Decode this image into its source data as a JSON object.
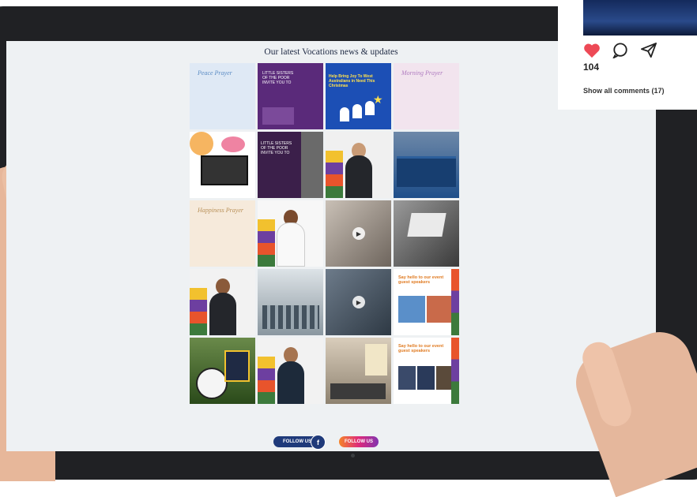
{
  "page": {
    "heading": "Our latest Vocations news & updates"
  },
  "tiles": [
    {
      "name": "tile-peace-prayer",
      "bg": "#dfe9f5",
      "text": "Peace Prayer",
      "color": "#5b8cc4"
    },
    {
      "name": "tile-little-sisters-1",
      "bg": "#5a2a7a",
      "text": "LITTLE SISTERS OF THE POOR INVITE YOU TO",
      "color": "#ffffff"
    },
    {
      "name": "tile-christmas",
      "bg": "#1c4fb5",
      "text": "Help Bring Joy To West Australians in Need This Christmas",
      "color": "#ffe14d"
    },
    {
      "name": "tile-morning-prayer",
      "bg": "#f2e4ee",
      "text": "Morning Prayer",
      "color": "#b07cc0"
    },
    {
      "name": "tile-paint-laptop",
      "bg": "#ffffff",
      "text": "",
      "color": "#333"
    },
    {
      "name": "tile-little-sisters-2",
      "bg": "#3b1f4a",
      "text": "LITTLE SISTERS OF THE POOR INVITE YOU TO",
      "color": "#ffffff"
    },
    {
      "name": "tile-priest-portrait",
      "bg": "#f0f0f0",
      "text": "",
      "color": "#333"
    },
    {
      "name": "tile-books",
      "bg": "#1f4f8a",
      "text": "",
      "color": "#fff"
    },
    {
      "name": "tile-happiness-prayer",
      "bg": "#f6eadb",
      "text": "Happiness Prayer",
      "color": "#b89058"
    },
    {
      "name": "tile-man-white",
      "bg": "#f7f7f7",
      "text": "",
      "color": "#333"
    },
    {
      "name": "tile-ordination-photo",
      "bg": "#8a7f76",
      "text": "",
      "color": "#fff"
    },
    {
      "name": "tile-laptop",
      "bg": "#6a6a6a",
      "text": "",
      "color": "#fff"
    },
    {
      "name": "tile-man-glasses",
      "bg": "#f2f2f2",
      "text": "",
      "color": "#333"
    },
    {
      "name": "tile-group-photo",
      "bg": "#b8c4cc",
      "text": "",
      "color": "#333"
    },
    {
      "name": "tile-video-event",
      "bg": "#4c5a6a",
      "text": "",
      "color": "#fff"
    },
    {
      "name": "tile-guest-speakers-1",
      "bg": "#ffffff",
      "text": "Say hello to our event guest speakers",
      "color": "#e07a20"
    },
    {
      "name": "tile-football",
      "bg": "#3c6a2a",
      "text": "",
      "color": "#fff"
    },
    {
      "name": "tile-man-jacket",
      "bg": "#f2f2f2",
      "text": "",
      "color": "#333"
    },
    {
      "name": "tile-stall",
      "bg": "#c7b9a4",
      "text": "",
      "color": "#333"
    },
    {
      "name": "tile-guest-speakers-2",
      "bg": "#ffffff",
      "text": "Say hello to our event guest speakers",
      "color": "#e07a20"
    }
  ],
  "social": {
    "facebook_label": "FOLLOW US",
    "facebook_icon": "f",
    "instagram_label": "FOLLOW US"
  },
  "post_card": {
    "likes": "104",
    "comments_link": "Show all comments (17)",
    "heart_color": "#ed4956"
  }
}
